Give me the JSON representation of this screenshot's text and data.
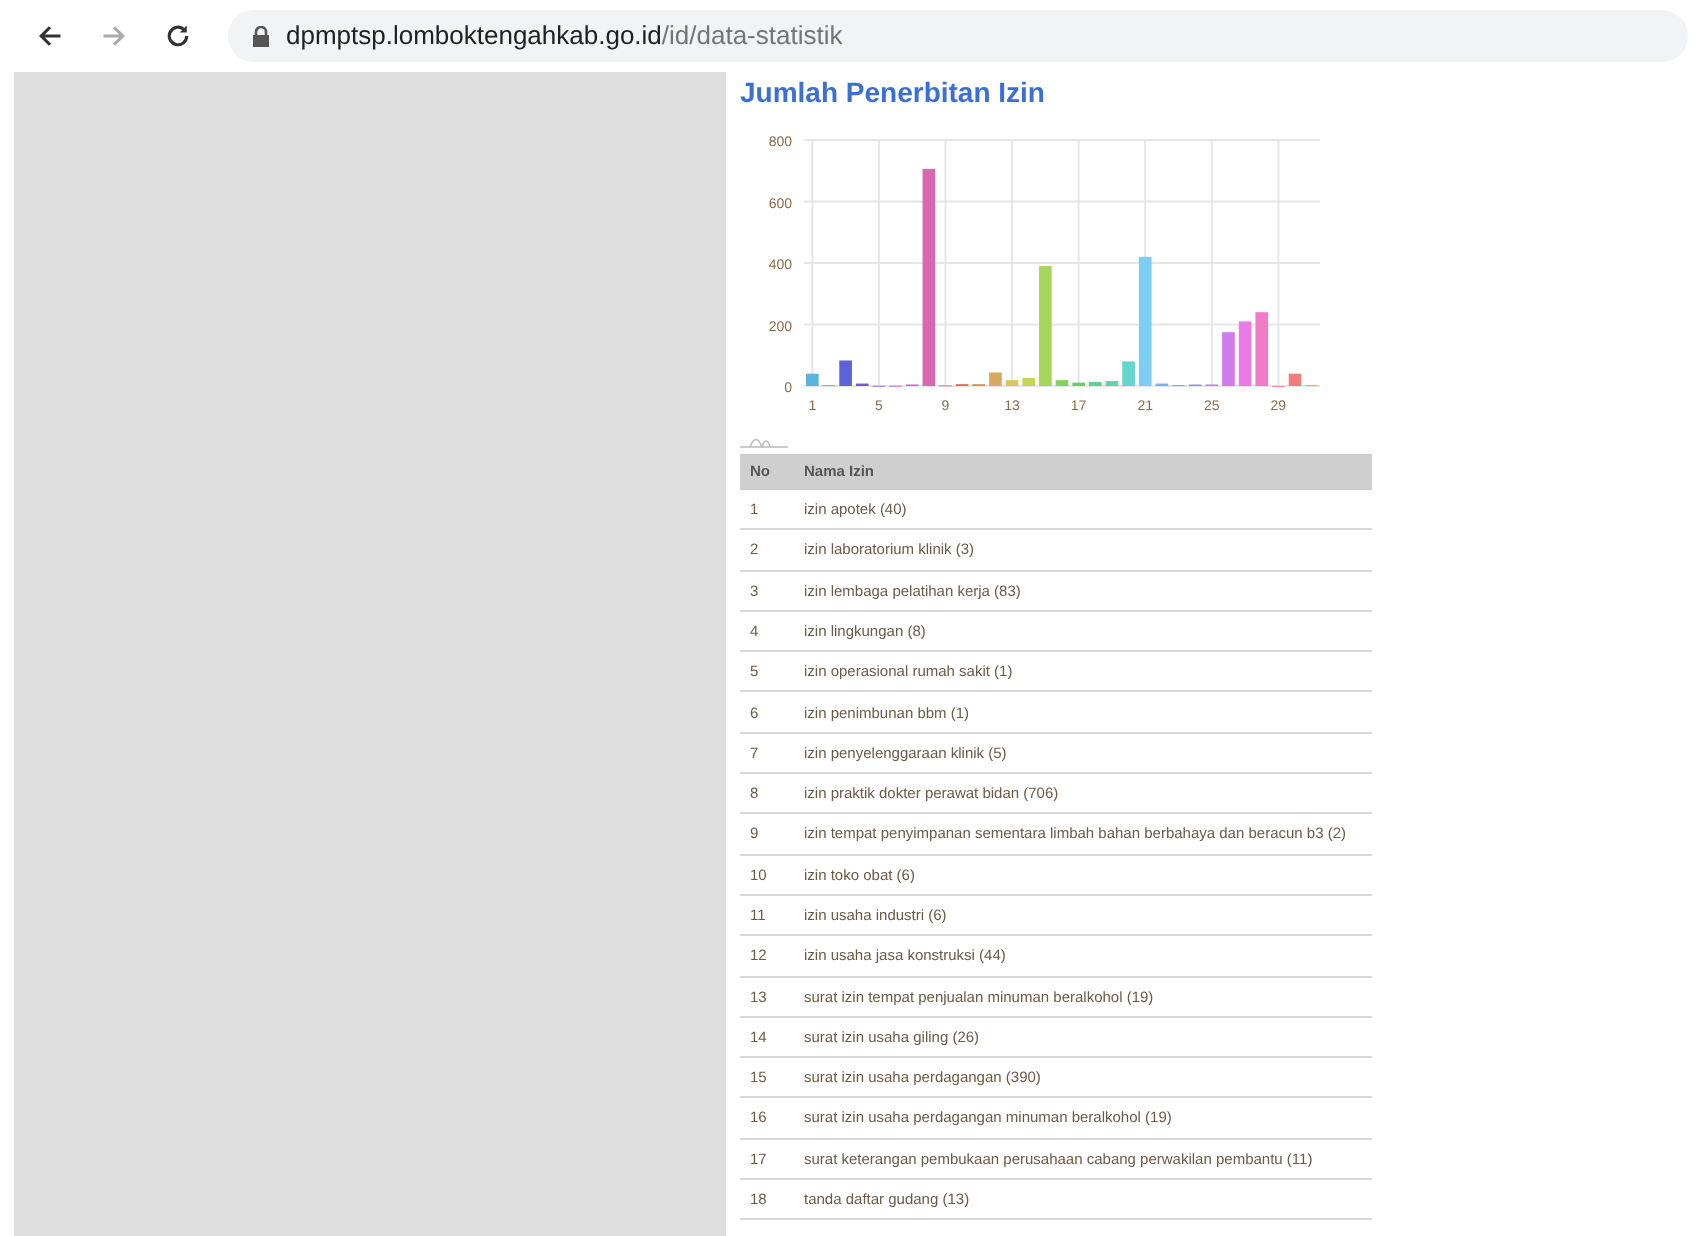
{
  "browser": {
    "url_host": "dpmptsp.lomboktengahkab.go.id",
    "url_path": "/id/data-statistik"
  },
  "title": "Jumlah Penerbitan Izin",
  "chart_data": {
    "type": "bar",
    "ylim": [
      0,
      800
    ],
    "yticks": [
      0,
      200,
      400,
      600,
      800
    ],
    "xticks": [
      1,
      5,
      9,
      13,
      17,
      21,
      25,
      29
    ],
    "grid": true,
    "xlim": [
      0.5,
      31.5
    ],
    "x": [
      1,
      2,
      3,
      4,
      5,
      6,
      7,
      8,
      9,
      10,
      11,
      12,
      13,
      14,
      15,
      16,
      17,
      18,
      19,
      20,
      21,
      22,
      23,
      24,
      25,
      26,
      27,
      28,
      29,
      30,
      31
    ],
    "series": [
      {
        "values": [
          40,
          3,
          83,
          8,
          1,
          1,
          5,
          706,
          2,
          6,
          6,
          44,
          19,
          26,
          390,
          19,
          11,
          13,
          16,
          80,
          420,
          8,
          3,
          5,
          5,
          175,
          210,
          240,
          0,
          40,
          3
        ]
      }
    ],
    "colors": [
      "#5ab4dc",
      "#7fa8e0",
      "#5b63d6",
      "#7a55d0",
      "#a064d8",
      "#c46ad8",
      "#d567c0",
      "#d869b0",
      "#e07a8a",
      "#e06a5a",
      "#e0904a",
      "#d9a860",
      "#d7c75a",
      "#c7d35a",
      "#a6d658",
      "#7fd25a",
      "#62d070",
      "#5ed08a",
      "#5fd3a6",
      "#62d6cc",
      "#7ccdf2",
      "#80aef0",
      "#8a9bec",
      "#9a90ea",
      "#b48ae8",
      "#d07aee",
      "#ea7ae8",
      "#f07ac8",
      "#f080a8",
      "#f07c7c",
      "#f0a08a"
    ]
  },
  "table": {
    "columns": [
      "No",
      "Nama Izin"
    ],
    "rows": [
      [
        "1",
        "izin apotek (40)"
      ],
      [
        "2",
        "izin laboratorium klinik (3)"
      ],
      [
        "3",
        "izin lembaga pelatihan kerja (83)"
      ],
      [
        "4",
        "izin lingkungan (8)"
      ],
      [
        "5",
        "izin operasional rumah sakit (1)"
      ],
      [
        "6",
        "izin penimbunan bbm (1)"
      ],
      [
        "7",
        "izin penyelenggaraan klinik (5)"
      ],
      [
        "8",
        "izin praktik dokter perawat bidan (706)"
      ],
      [
        "9",
        "izin tempat penyimpanan sementara limbah bahan berbahaya dan beracun b3 (2)"
      ],
      [
        "10",
        "izin toko obat (6)"
      ],
      [
        "11",
        "izin usaha industri (6)"
      ],
      [
        "12",
        "izin usaha jasa konstruksi (44)"
      ],
      [
        "13",
        "surat izin tempat penjualan minuman beralkohol (19)"
      ],
      [
        "14",
        "surat izin usaha giling (26)"
      ],
      [
        "15",
        "surat izin usaha perdagangan (390)"
      ],
      [
        "16",
        "surat izin usaha perdagangan minuman beralkohol (19)"
      ],
      [
        "17",
        "surat keterangan pembukaan perusahaan cabang perwakilan pembantu (11)"
      ],
      [
        "18",
        "tanda daftar gudang (13)"
      ]
    ]
  }
}
